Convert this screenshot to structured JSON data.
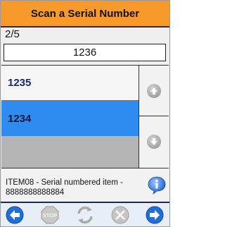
{
  "header": {
    "title": "Scan a Serial Number"
  },
  "progress": {
    "counter": "2/5"
  },
  "serial_input": {
    "value": "1236"
  },
  "serial_list": {
    "items": [
      {
        "label": "1235",
        "selected": false
      },
      {
        "label": "1234",
        "selected": true
      }
    ]
  },
  "item_info": {
    "line1": "ITEM08 - Serial numbered item -",
    "line2": "8888888888884"
  },
  "toolbar": {
    "stop_label": "STOP"
  },
  "colors": {
    "header_bg": "#f79a2b",
    "selected_row": "#2e8bf0",
    "toolbar_accent": "#1f6fd9"
  }
}
